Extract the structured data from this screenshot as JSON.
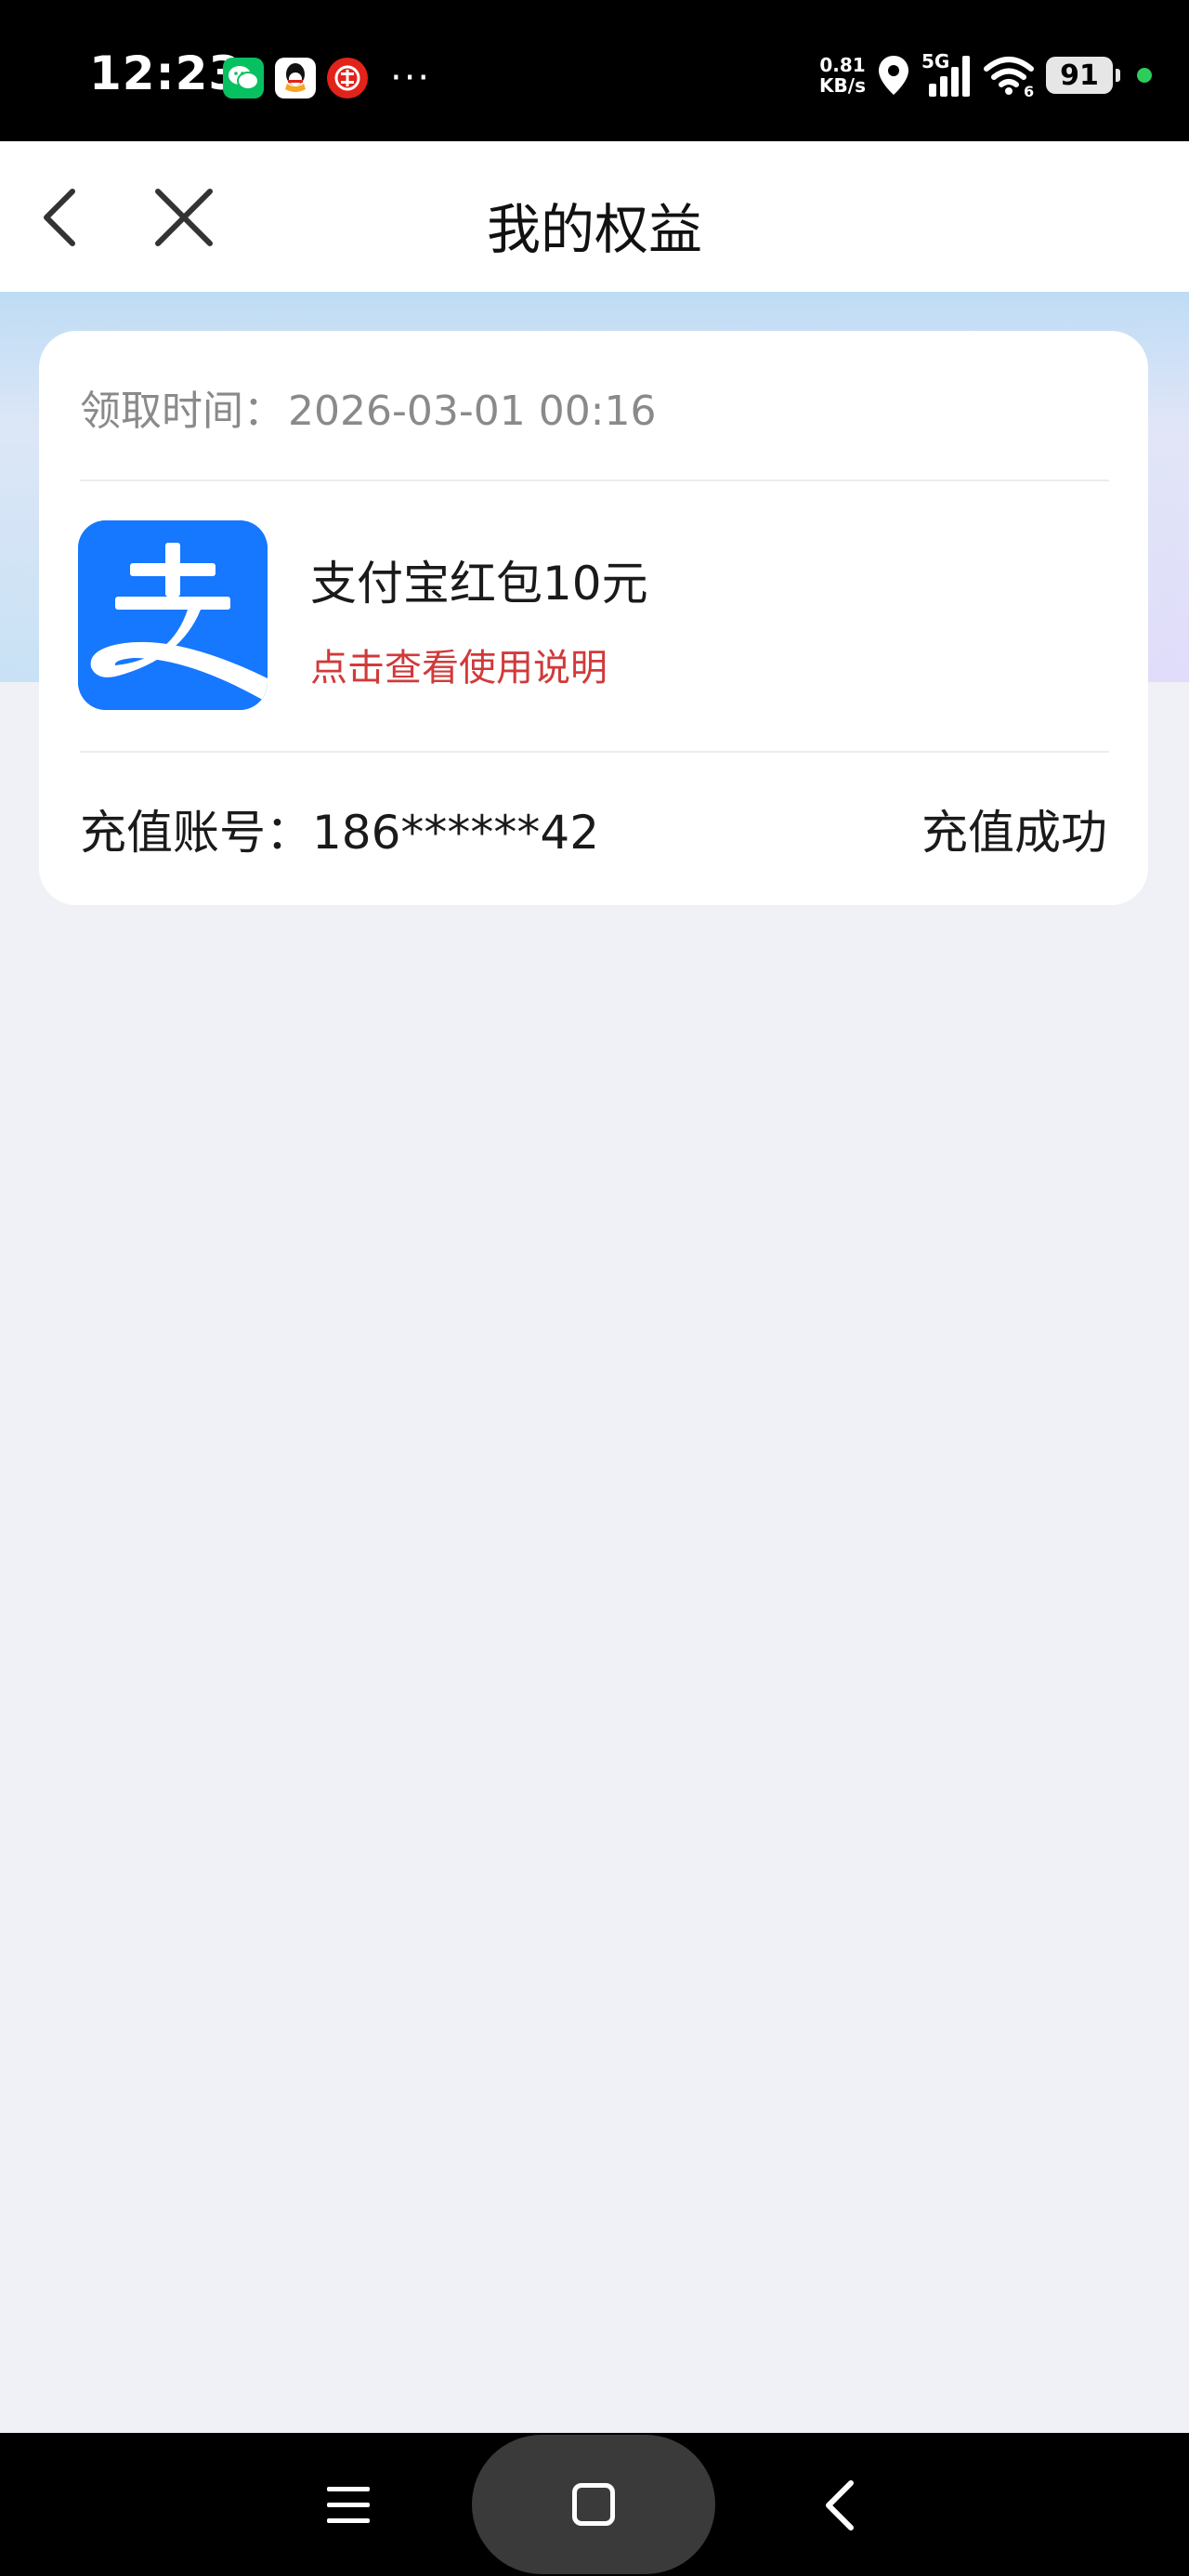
{
  "status_bar": {
    "time": "12:23",
    "net_speed_value": "0.81",
    "net_speed_unit": "KB/s",
    "network": "5G",
    "wifi_sub": "6",
    "battery": "91",
    "notification_icons": [
      "wechat-icon",
      "qq-icon",
      "bank-icon"
    ],
    "more": "···"
  },
  "nav": {
    "title": "我的权益",
    "back_icon": "chevron-left-icon",
    "close_icon": "close-icon"
  },
  "card": {
    "claim_label": "领取时间：",
    "claim_time": "2026-03-01 00:16",
    "benefit_logo_text": "支",
    "benefit_name": "支付宝红包10元",
    "benefit_link": "点击查看使用说明",
    "account_label": "充值账号：",
    "account_value": "186******42",
    "status": "充值成功"
  },
  "colors": {
    "alipay_blue": "#1677ff",
    "link_red": "#d13a3a",
    "page_bg": "#eff1f6"
  },
  "bottom_nav": {
    "menu_icon": "menu-icon",
    "home_icon": "home-icon",
    "back_icon": "back-icon"
  }
}
